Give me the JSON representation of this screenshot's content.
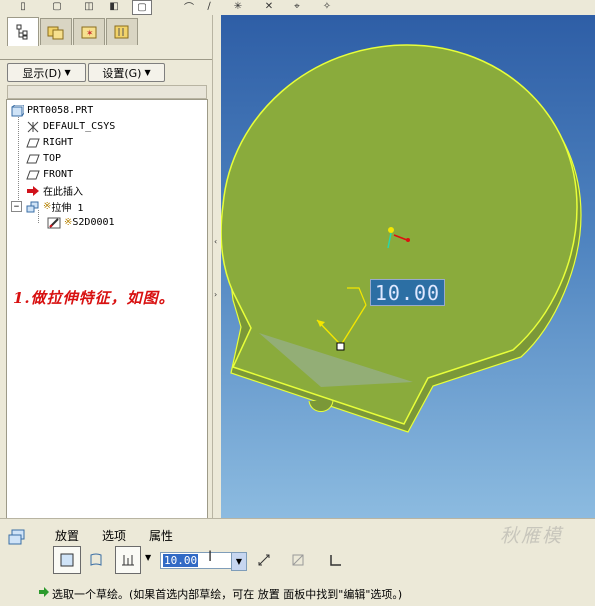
{
  "toolbar": {
    "left_icons": [
      "view-icon",
      "display-icon",
      "repaint-icon",
      "zoom-icon",
      "orient-icon"
    ],
    "right_icons": [
      "datum-plane-icon",
      "datum-axis-icon",
      "datum-point-icon",
      "csys-icon",
      "spin-center-icon",
      "annotation-icon"
    ]
  },
  "nav_tabs": [
    {
      "name": "model-tree",
      "icon": "model-tree-icon"
    },
    {
      "name": "folder-browser",
      "icon": "folder-icon"
    },
    {
      "name": "favorites",
      "icon": "favorites-icon"
    },
    {
      "name": "connections",
      "icon": "connections-icon"
    }
  ],
  "tree_controls": {
    "show_label": "显示(D)",
    "settings_label": "设置(G)"
  },
  "model_tree": {
    "root": "PRT0058.PRT",
    "items": [
      {
        "label": "DEFAULT_CSYS",
        "icon": "csys-icon"
      },
      {
        "label": "RIGHT",
        "icon": "datum-plane-icon"
      },
      {
        "label": "TOP",
        "icon": "datum-plane-icon"
      },
      {
        "label": "FRONT",
        "icon": "datum-plane-icon"
      },
      {
        "label": "在此插入",
        "icon": "insert-here-arrow-icon"
      },
      {
        "label": "拉伸 1",
        "icon": "extrude-icon",
        "prefix": "※"
      },
      {
        "label": "S2D0001",
        "icon": "sketch-icon",
        "prefix": "※"
      }
    ]
  },
  "annotation": "1.做拉伸特征，如图。",
  "viewport": {
    "dimension_value": "10.00",
    "colors": {
      "background_top": "#2e5ea6",
      "background_bottom": "#8cbbe0",
      "part_fill": "#8aab3c",
      "part_edge": "#e8ff3a"
    }
  },
  "dashboard": {
    "tabs": [
      "放置",
      "选项",
      "属性"
    ],
    "depth_value": "10.00",
    "buttons": [
      "solid-button",
      "surface-button",
      "depth-option-button",
      "flip-direction-button",
      "remove-material-button",
      "thicken-button"
    ],
    "status_text": "选取一个草绘。(如果首选内部草绘，可在 放置 面板中找到\"编辑\"选项。)",
    "watermark": "秋雁模"
  }
}
